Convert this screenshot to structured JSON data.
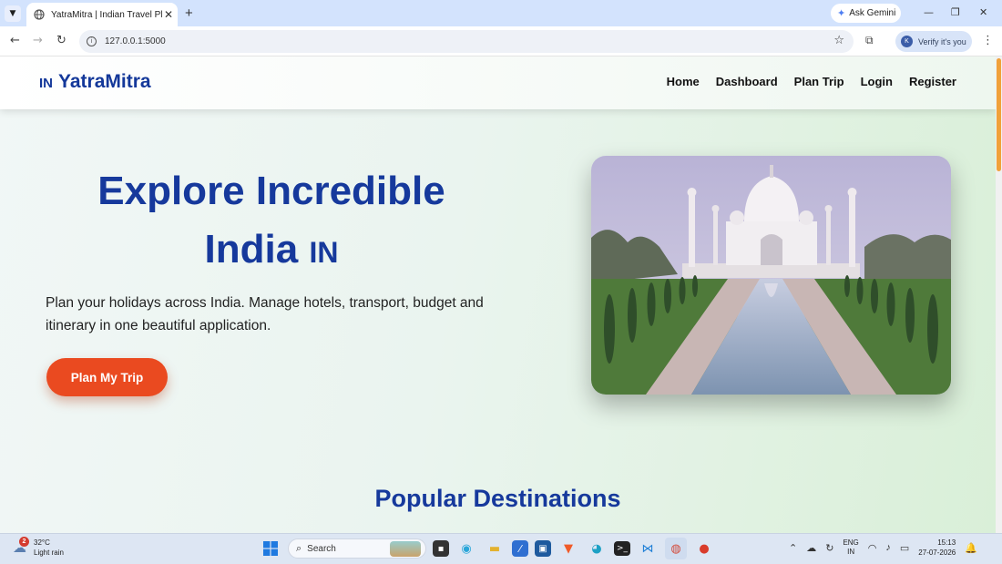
{
  "browser": {
    "tab_title": "YatraMitra | Indian Travel Planner",
    "tab_close": "✕",
    "new_tab": "+",
    "gemini_label": "Ask Gemini",
    "url": "127.0.0.1:5000",
    "profile_initial": "K",
    "profile_label": "Verify it's you"
  },
  "site": {
    "brand_flag": "IN",
    "brand_name": "YatraMitra",
    "nav": [
      "Home",
      "Dashboard",
      "Plan Trip",
      "Login",
      "Register"
    ],
    "hero_title_line1": "Explore Incredible",
    "hero_title_line2": "India",
    "hero_flag": "IN",
    "hero_subtitle": "Plan your holidays across India. Manage hotels, transport, budget and itinerary in one beautiful application.",
    "cta_label": "Plan My Trip",
    "section_title": "Popular Destinations"
  },
  "taskbar": {
    "weather_badge": "2",
    "temperature": "32°C",
    "weather_desc": "Light rain",
    "search_label": "Search",
    "lang_top": "ENG",
    "lang_bottom": "IN",
    "time": "15:13",
    "date": "27-07-2026"
  },
  "colors": {
    "brand_blue": "#16399c",
    "cta_orange": "#ea4a20",
    "scroll_thumb": "#f0a13a"
  }
}
